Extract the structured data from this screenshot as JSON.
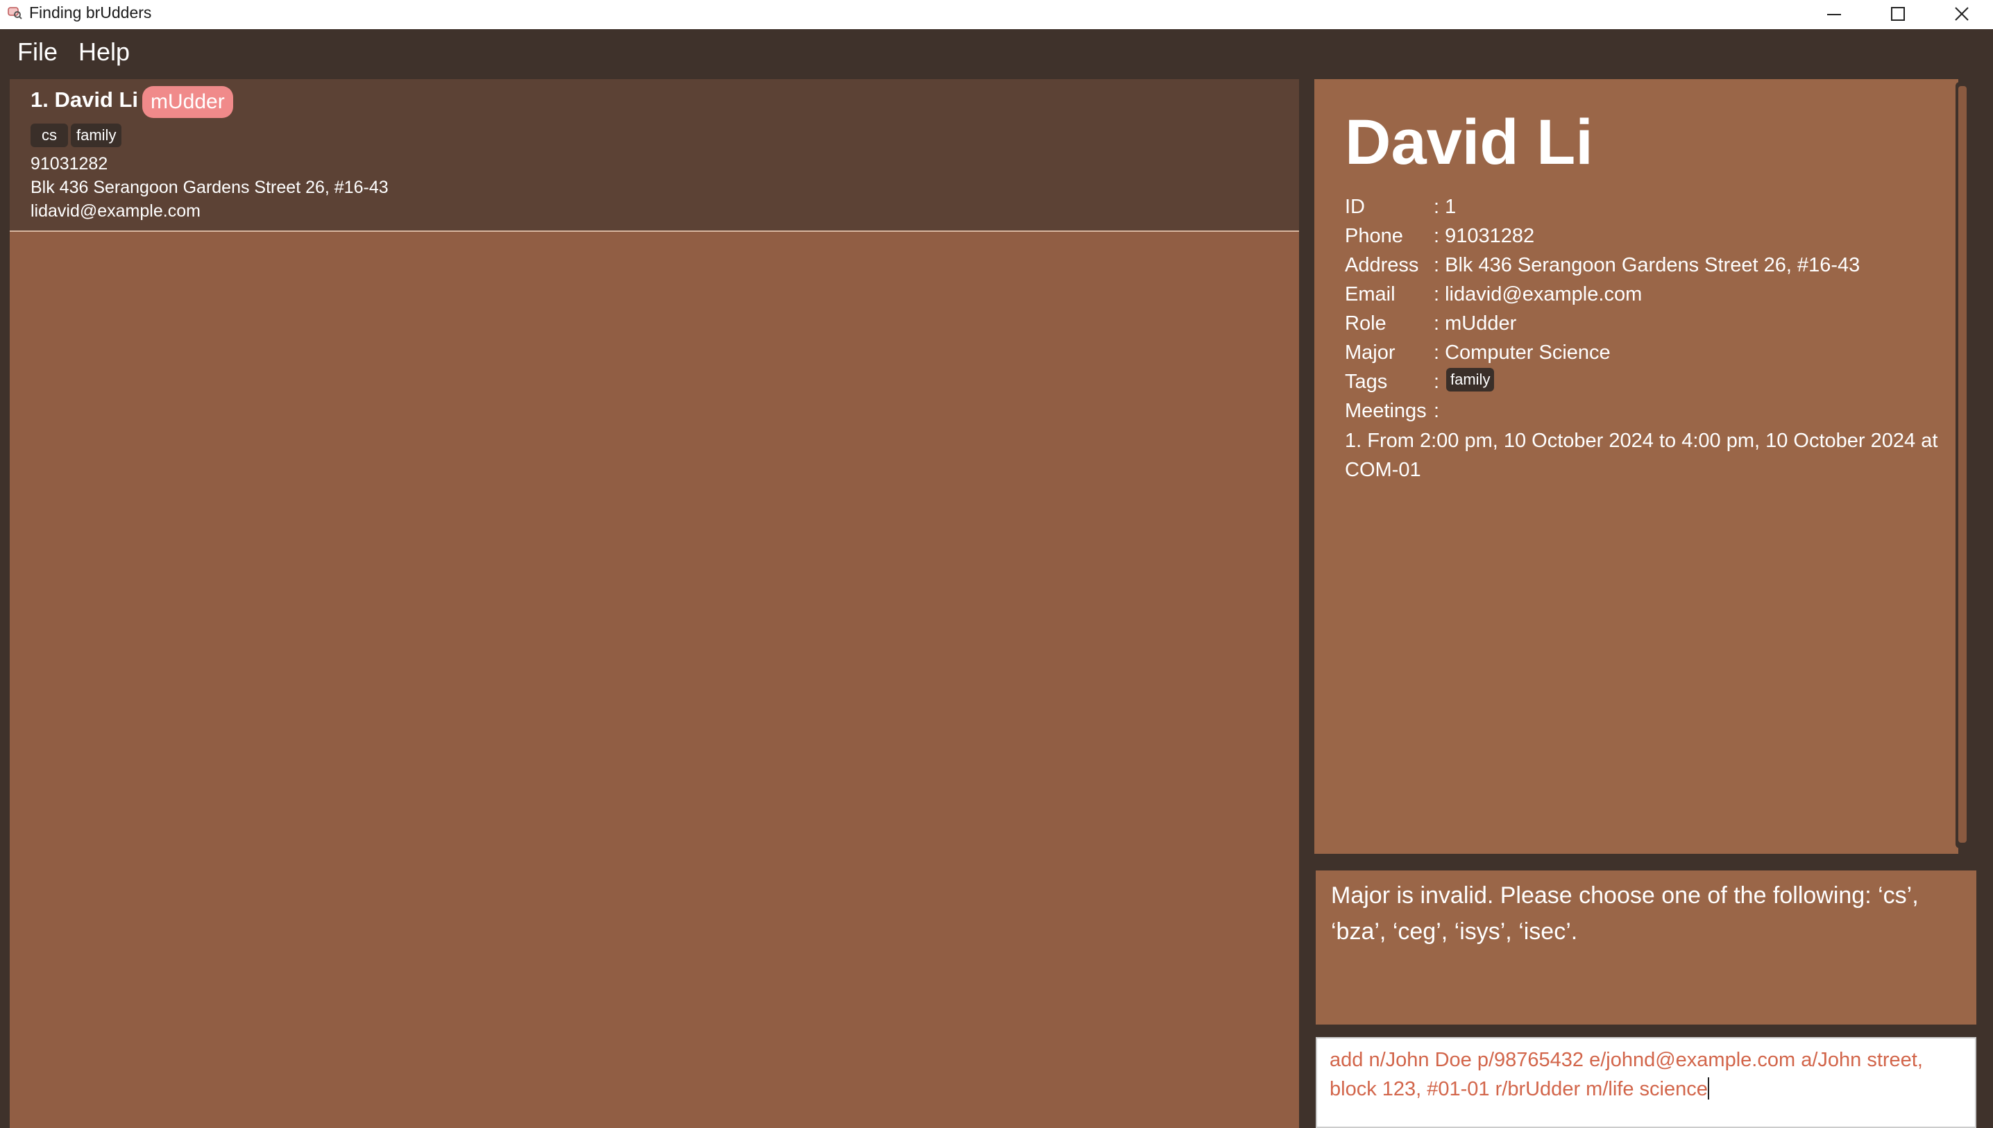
{
  "window": {
    "title": "Finding brUdders",
    "app_icon": "cow-search-icon"
  },
  "menu": {
    "file": "File",
    "help": "Help"
  },
  "person_list": [
    {
      "name": "1. David Li",
      "role": "mUdder",
      "tags": [
        "cs",
        "family"
      ],
      "phone": "91031282",
      "address": "Blk 436 Serangoon Gardens Street 26, #16-43",
      "email": "lidavid@example.com"
    }
  ],
  "detail": {
    "name": "David Li",
    "fields": [
      {
        "label": "ID",
        "value": ": 1"
      },
      {
        "label": "Phone",
        "value": ": 91031282"
      },
      {
        "label": "Address",
        "value": ": Blk 436 Serangoon Gardens Street 26, #16-43"
      },
      {
        "label": "Email",
        "value": ": lidavid@example.com"
      },
      {
        "label": "Role",
        "value": ": mUdder"
      },
      {
        "label": "Major",
        "value": ": Computer Science"
      },
      {
        "label": "Tags",
        "value": ":"
      },
      {
        "label": "Meetings",
        "value": ":"
      }
    ],
    "tag": "family",
    "meeting": "1. From 2:00 pm, 10 October 2024 to 4:00 pm, 10 October 2024 at COM-01"
  },
  "result": {
    "message": "Major is invalid. Please choose one of the following: ‘cs’, ‘bza’, ‘ceg’, ‘isys’, ‘isec’."
  },
  "command": {
    "value": "add n/John Doe p/98765432 e/johnd@example.com a/John street, block 123, #01-01 r/brUdder m/life science"
  },
  "colors": {
    "background": "#3f322b",
    "list_bg": "#915e44",
    "card_bg": "#5c4235",
    "detail_bg": "#9a6648",
    "role_badge": "#f08a8a",
    "command_text": "#d2654a"
  }
}
